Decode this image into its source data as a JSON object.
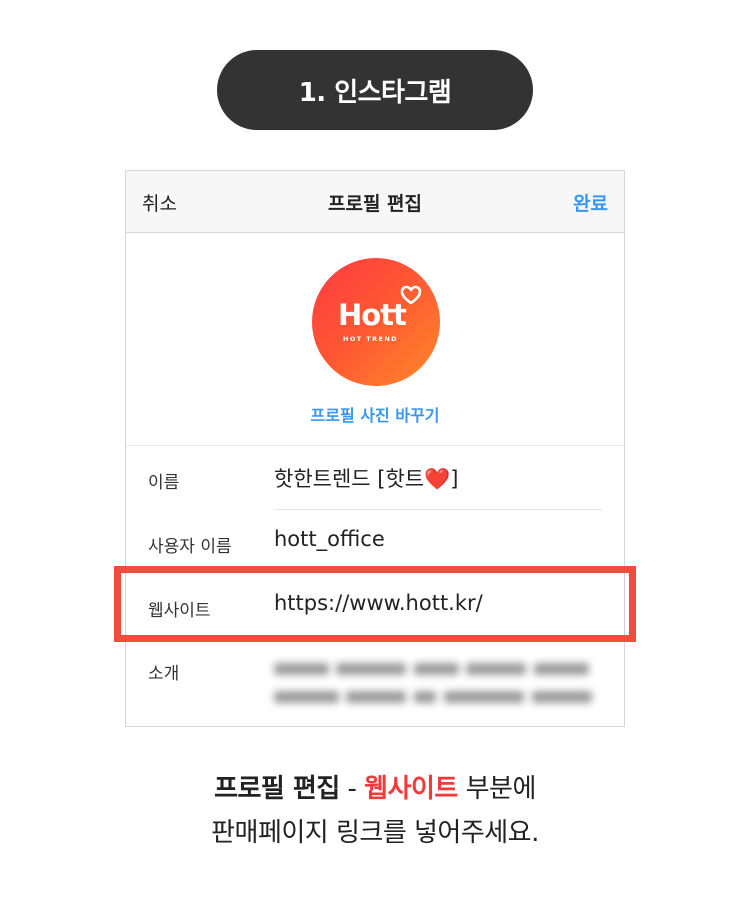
{
  "step_label": "1. 인스타그램",
  "header": {
    "cancel": "취소",
    "title": "프로필 편집",
    "done": "완료"
  },
  "profile": {
    "logo_text": "Hott",
    "logo_subtext": "HOT TREND",
    "change_photo": "프로필 사진 바꾸기"
  },
  "fields": {
    "name": {
      "label": "이름",
      "value": "핫한트렌드 [핫트❤️]"
    },
    "username": {
      "label": "사용자 이름",
      "value": "hott_office"
    },
    "website": {
      "label": "웹사이트",
      "value": "https://www.hott.kr/"
    },
    "bio": {
      "label": "소개",
      "value": ""
    }
  },
  "caption": {
    "line1_part1": "프로필 편집",
    "line1_sep": " - ",
    "line1_highlight": "웹사이트",
    "line1_part2": " 부분에",
    "line2": "판매페이지 링크를 넣어주세요."
  },
  "colors": {
    "pill_bg": "#333333",
    "link_blue": "#3897f0",
    "highlight_red": "#f24c3d",
    "avatar_gradient_start": "#ff3c45",
    "avatar_gradient_end": "#ff8a2a"
  }
}
